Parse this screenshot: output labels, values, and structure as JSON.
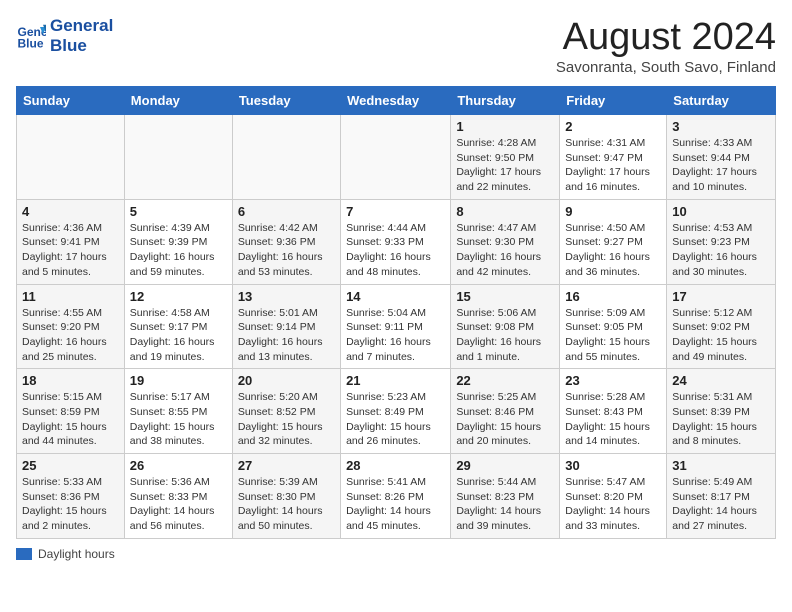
{
  "header": {
    "logo_line1": "General",
    "logo_line2": "Blue",
    "month_title": "August 2024",
    "subtitle": "Savonranta, South Savo, Finland"
  },
  "days_of_week": [
    "Sunday",
    "Monday",
    "Tuesday",
    "Wednesday",
    "Thursday",
    "Friday",
    "Saturday"
  ],
  "weeks": [
    [
      {
        "day": "",
        "info": ""
      },
      {
        "day": "",
        "info": ""
      },
      {
        "day": "",
        "info": ""
      },
      {
        "day": "",
        "info": ""
      },
      {
        "day": "1",
        "info": "Sunrise: 4:28 AM\nSunset: 9:50 PM\nDaylight: 17 hours and 22 minutes."
      },
      {
        "day": "2",
        "info": "Sunrise: 4:31 AM\nSunset: 9:47 PM\nDaylight: 17 hours and 16 minutes."
      },
      {
        "day": "3",
        "info": "Sunrise: 4:33 AM\nSunset: 9:44 PM\nDaylight: 17 hours and 10 minutes."
      }
    ],
    [
      {
        "day": "4",
        "info": "Sunrise: 4:36 AM\nSunset: 9:41 PM\nDaylight: 17 hours and 5 minutes."
      },
      {
        "day": "5",
        "info": "Sunrise: 4:39 AM\nSunset: 9:39 PM\nDaylight: 16 hours and 59 minutes."
      },
      {
        "day": "6",
        "info": "Sunrise: 4:42 AM\nSunset: 9:36 PM\nDaylight: 16 hours and 53 minutes."
      },
      {
        "day": "7",
        "info": "Sunrise: 4:44 AM\nSunset: 9:33 PM\nDaylight: 16 hours and 48 minutes."
      },
      {
        "day": "8",
        "info": "Sunrise: 4:47 AM\nSunset: 9:30 PM\nDaylight: 16 hours and 42 minutes."
      },
      {
        "day": "9",
        "info": "Sunrise: 4:50 AM\nSunset: 9:27 PM\nDaylight: 16 hours and 36 minutes."
      },
      {
        "day": "10",
        "info": "Sunrise: 4:53 AM\nSunset: 9:23 PM\nDaylight: 16 hours and 30 minutes."
      }
    ],
    [
      {
        "day": "11",
        "info": "Sunrise: 4:55 AM\nSunset: 9:20 PM\nDaylight: 16 hours and 25 minutes."
      },
      {
        "day": "12",
        "info": "Sunrise: 4:58 AM\nSunset: 9:17 PM\nDaylight: 16 hours and 19 minutes."
      },
      {
        "day": "13",
        "info": "Sunrise: 5:01 AM\nSunset: 9:14 PM\nDaylight: 16 hours and 13 minutes."
      },
      {
        "day": "14",
        "info": "Sunrise: 5:04 AM\nSunset: 9:11 PM\nDaylight: 16 hours and 7 minutes."
      },
      {
        "day": "15",
        "info": "Sunrise: 5:06 AM\nSunset: 9:08 PM\nDaylight: 16 hours and 1 minute."
      },
      {
        "day": "16",
        "info": "Sunrise: 5:09 AM\nSunset: 9:05 PM\nDaylight: 15 hours and 55 minutes."
      },
      {
        "day": "17",
        "info": "Sunrise: 5:12 AM\nSunset: 9:02 PM\nDaylight: 15 hours and 49 minutes."
      }
    ],
    [
      {
        "day": "18",
        "info": "Sunrise: 5:15 AM\nSunset: 8:59 PM\nDaylight: 15 hours and 44 minutes."
      },
      {
        "day": "19",
        "info": "Sunrise: 5:17 AM\nSunset: 8:55 PM\nDaylight: 15 hours and 38 minutes."
      },
      {
        "day": "20",
        "info": "Sunrise: 5:20 AM\nSunset: 8:52 PM\nDaylight: 15 hours and 32 minutes."
      },
      {
        "day": "21",
        "info": "Sunrise: 5:23 AM\nSunset: 8:49 PM\nDaylight: 15 hours and 26 minutes."
      },
      {
        "day": "22",
        "info": "Sunrise: 5:25 AM\nSunset: 8:46 PM\nDaylight: 15 hours and 20 minutes."
      },
      {
        "day": "23",
        "info": "Sunrise: 5:28 AM\nSunset: 8:43 PM\nDaylight: 15 hours and 14 minutes."
      },
      {
        "day": "24",
        "info": "Sunrise: 5:31 AM\nSunset: 8:39 PM\nDaylight: 15 hours and 8 minutes."
      }
    ],
    [
      {
        "day": "25",
        "info": "Sunrise: 5:33 AM\nSunset: 8:36 PM\nDaylight: 15 hours and 2 minutes."
      },
      {
        "day": "26",
        "info": "Sunrise: 5:36 AM\nSunset: 8:33 PM\nDaylight: 14 hours and 56 minutes."
      },
      {
        "day": "27",
        "info": "Sunrise: 5:39 AM\nSunset: 8:30 PM\nDaylight: 14 hours and 50 minutes."
      },
      {
        "day": "28",
        "info": "Sunrise: 5:41 AM\nSunset: 8:26 PM\nDaylight: 14 hours and 45 minutes."
      },
      {
        "day": "29",
        "info": "Sunrise: 5:44 AM\nSunset: 8:23 PM\nDaylight: 14 hours and 39 minutes."
      },
      {
        "day": "30",
        "info": "Sunrise: 5:47 AM\nSunset: 8:20 PM\nDaylight: 14 hours and 33 minutes."
      },
      {
        "day": "31",
        "info": "Sunrise: 5:49 AM\nSunset: 8:17 PM\nDaylight: 14 hours and 27 minutes."
      }
    ]
  ],
  "legend": {
    "label": "Daylight hours"
  }
}
